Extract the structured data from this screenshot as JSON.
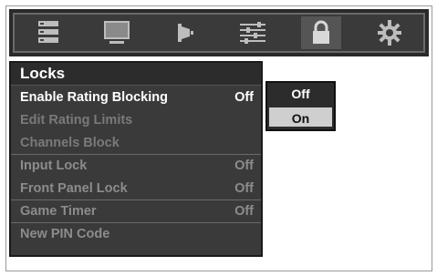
{
  "tabs": [
    {
      "icon": "list-icon"
    },
    {
      "icon": "monitor-icon"
    },
    {
      "icon": "speaker-icon"
    },
    {
      "icon": "sliders-icon"
    },
    {
      "icon": "lock-icon"
    },
    {
      "icon": "gear-icon"
    }
  ],
  "menu": {
    "title": "Locks",
    "items": [
      {
        "label": "Enable Rating Blocking",
        "value": "Off"
      },
      {
        "label": "Edit Rating Limits",
        "value": ""
      },
      {
        "label": "Channels Block",
        "value": ""
      },
      {
        "label": "Input Lock",
        "value": "Off"
      },
      {
        "label": "Front Panel Lock",
        "value": "Off"
      },
      {
        "label": "Game Timer",
        "value": "Off"
      },
      {
        "label": "New PIN Code",
        "value": ""
      }
    ]
  },
  "popup": {
    "options": [
      "Off",
      "On"
    ],
    "highlighted": "On"
  },
  "colors": {
    "bar_bg": "#2a2a2a",
    "menu_bg": "#3a3a3a",
    "highlight": "#cfcfcf"
  }
}
